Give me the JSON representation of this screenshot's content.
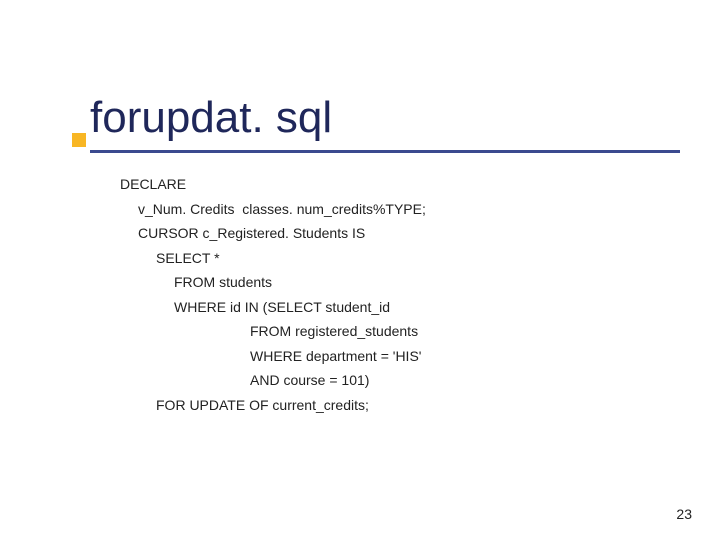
{
  "title": "forupdat. sql",
  "code": {
    "l1": "DECLARE",
    "l2": "v_Num. Credits  classes. num_credits%TYPE;",
    "l3": "CURSOR c_Registered. Students IS",
    "l4": "SELECT *",
    "l5": "FROM students",
    "l6": "WHERE id IN (SELECT student_id",
    "l7": "FROM registered_students",
    "l8": "WHERE department = 'HIS'",
    "l9": "AND course = 101)",
    "l10": "FOR UPDATE OF current_credits;"
  },
  "page_number": "23"
}
